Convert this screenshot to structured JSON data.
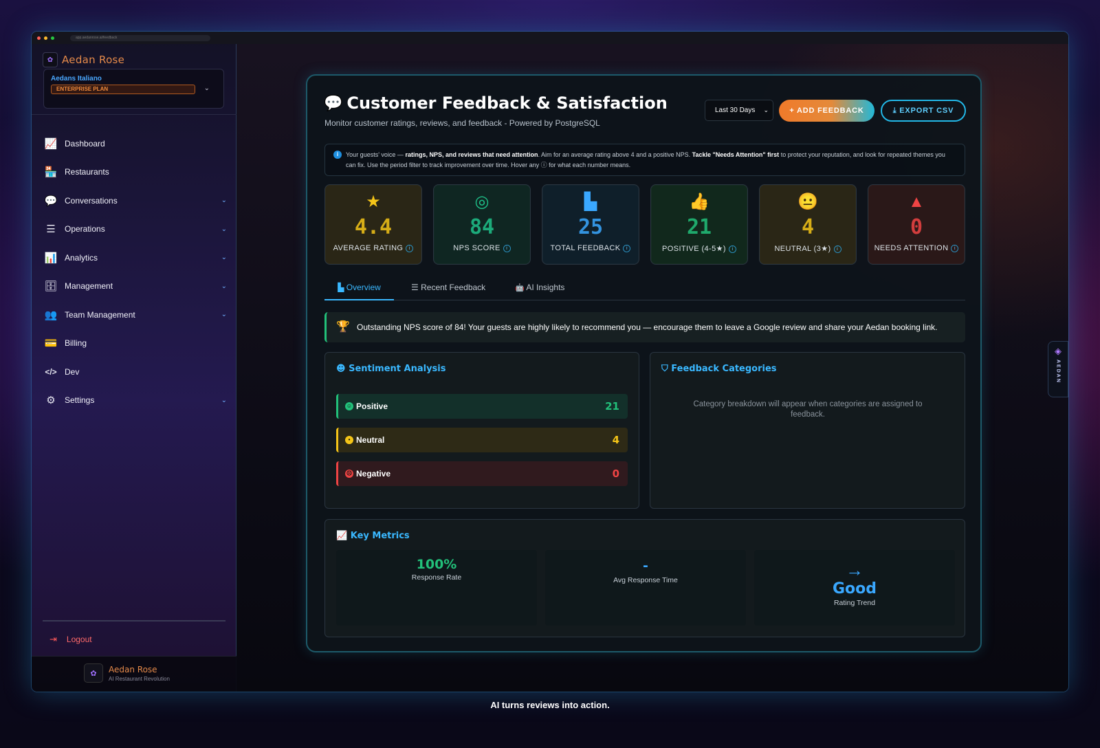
{
  "browser": {
    "url": "app.aedanrose.ai/feedback"
  },
  "sidebar": {
    "brand": "Aedan Rose",
    "org_name": "Aedans Italiano",
    "plan": "ENTERPRISE PLAN",
    "items": [
      {
        "label": "Dashboard",
        "icon": "chart-line-icon",
        "glyph": "📈"
      },
      {
        "label": "Restaurants",
        "icon": "store-icon",
        "glyph": "🏪"
      },
      {
        "label": "Conversations",
        "icon": "comments-icon",
        "glyph": "💬"
      },
      {
        "label": "Operations",
        "icon": "tasks-icon",
        "glyph": "☰"
      },
      {
        "label": "Analytics",
        "icon": "chart-bar-icon",
        "glyph": "📊"
      },
      {
        "label": "Management",
        "icon": "database-icon",
        "glyph": "🗄"
      },
      {
        "label": "Team Management",
        "icon": "users-icon",
        "glyph": "👥"
      },
      {
        "label": "Billing",
        "icon": "credit-card-icon",
        "glyph": "💳"
      },
      {
        "label": "Dev",
        "icon": "code-icon",
        "glyph": "</>"
      },
      {
        "label": "Settings",
        "icon": "gear-icon",
        "glyph": "⚙"
      }
    ],
    "logout": "Logout",
    "footer_name": "Aedan Rose",
    "footer_sub": "AI Restaurant Revolution"
  },
  "header": {
    "title": "Customer Feedback & Satisfaction",
    "subtitle": "Monitor customer ratings, reviews, and feedback - Powered by PostgreSQL",
    "period": "Last 30 Days",
    "add_label": "+ ADD FEEDBACK",
    "export_label": "⤓ EXPORT CSV"
  },
  "info": {
    "text_1": "Your guests' voice — ",
    "bold_1": "ratings, NPS, and reviews that need attention",
    "text_2": ". Aim for an average rating above 4 and a positive NPS. ",
    "bold_2": "Tackle \"Needs Attention\" first",
    "text_3": " to protect your reputation, and look for repeated themes you can fix. Use the period filter to track improvement over time. Hover any ⓘ for what each number means."
  },
  "stats": [
    {
      "value": "4.4",
      "label": "AVERAGE RATING",
      "icon": "star-icon",
      "glyph": "★",
      "color": "#f5c518",
      "bg": "#2a2616"
    },
    {
      "value": "84",
      "label": "NPS SCORE",
      "icon": "target-icon",
      "glyph": "◎",
      "color": "#1fc28a",
      "bg": "#0f2622"
    },
    {
      "value": "25",
      "label": "TOTAL FEEDBACK",
      "icon": "chart-bar-icon",
      "glyph": "▙",
      "color": "#3aa8ff",
      "bg": "#0f1f2a"
    },
    {
      "value": "21",
      "label": "POSITIVE (4-5★)",
      "icon": "thumbs-up-icon",
      "glyph": "👍",
      "color": "#22c07a",
      "bg": "#11281c"
    },
    {
      "value": "4",
      "label": "NEUTRAL (3★)",
      "icon": "neutral-face-icon",
      "glyph": "😐",
      "color": "#f5c518",
      "bg": "#2a2616"
    },
    {
      "value": "0",
      "label": "NEEDS ATTENTION",
      "icon": "warning-icon",
      "glyph": "▲",
      "color": "#ef4444",
      "bg": "#2a1818"
    }
  ],
  "tabs": [
    {
      "label": "Overview",
      "glyph": "▙"
    },
    {
      "label": "Recent Feedback",
      "glyph": "☰"
    },
    {
      "label": "AI Insights",
      "glyph": "🤖"
    }
  ],
  "banner": "Outstanding NPS score of 84! Your guests are highly likely to recommend you — encourage them to leave a Google review and share your Aedan booking link.",
  "sentiment": {
    "title": "Sentiment Analysis",
    "rows": [
      {
        "label": "Positive",
        "count": "21",
        "color": "#22c07a",
        "bg": "#13302a"
      },
      {
        "label": "Neutral",
        "count": "4",
        "color": "#f5c518",
        "bg": "#2e2a16"
      },
      {
        "label": "Negative",
        "count": "0",
        "color": "#ef4444",
        "bg": "#301a1e"
      }
    ]
  },
  "categories": {
    "title": "Feedback Categories",
    "empty": "Category breakdown will appear when categories are assigned to feedback."
  },
  "key_metrics": {
    "title": "Key Metrics",
    "items": [
      {
        "value": "100%",
        "label": "Response Rate",
        "color": "#22c07a"
      },
      {
        "value": "-",
        "label": "Avg Response Time",
        "color": "#3aa8ff"
      },
      {
        "value": "Good",
        "label": "Rating Trend",
        "color": "#3aa8ff",
        "arrow": "→"
      }
    ]
  },
  "side_tab": "AEDAN",
  "tagline": "AI turns reviews into action.",
  "colors": {
    "accent": "#3ab8ff",
    "brand": "#e58a4a",
    "positive": "#22c07a",
    "warning": "#f5c518",
    "danger": "#ef4444"
  }
}
